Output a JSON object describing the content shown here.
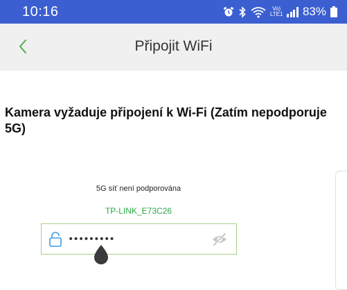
{
  "status_bar": {
    "time": "10:16",
    "network_label": "Vo)\nLTE1",
    "battery": "83%"
  },
  "header": {
    "title": "Připojit WiFi"
  },
  "main": {
    "heading_line1": "Kamera vyžaduje připojení k Wi-Fi (Zatím nepodporuje",
    "heading_line2": "5G)",
    "note_5g": "5G síť není podporována",
    "ssid": "TP-LINK_E73C26",
    "password_value": "•••••••••"
  },
  "colors": {
    "status_bar": "#3b5fd1",
    "header_bg": "#f0f0f0",
    "accent_green": "#2aa845",
    "field_border": "#a6cf8e",
    "back_arrow": "#4cae4c"
  },
  "icons": {
    "back": "chevron-left-icon",
    "lock": "lock-icon",
    "visibility": "eye-off-icon"
  }
}
